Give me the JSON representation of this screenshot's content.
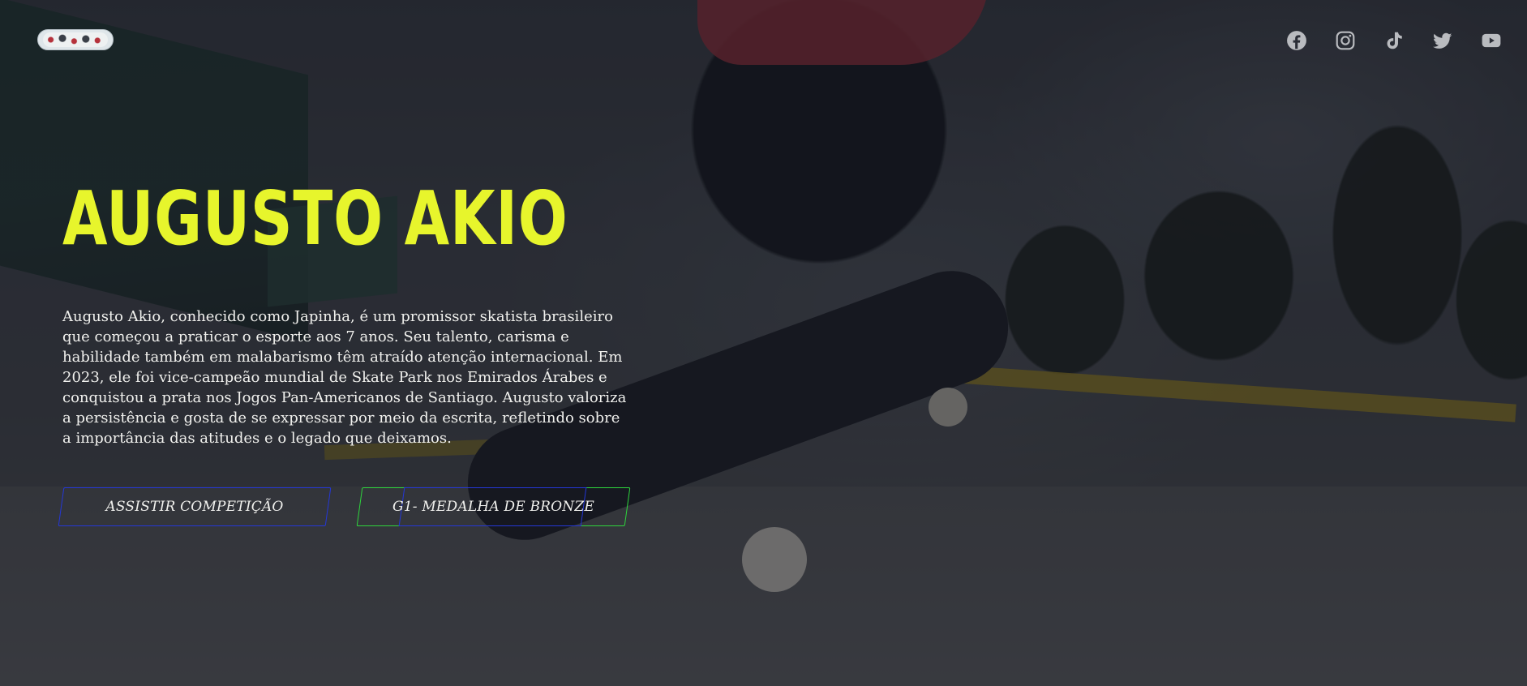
{
  "page": {
    "accent_color": "#e7f52c"
  },
  "header": {
    "logo_icon": "skateboard-logo-icon",
    "social": [
      {
        "name": "facebook",
        "icon": "facebook-icon"
      },
      {
        "name": "instagram",
        "icon": "instagram-icon"
      },
      {
        "name": "tiktok",
        "icon": "tiktok-icon"
      },
      {
        "name": "twitter",
        "icon": "twitter-icon"
      },
      {
        "name": "youtube",
        "icon": "youtube-icon"
      }
    ],
    "icon_color": "#b9bbbf"
  },
  "hero": {
    "title": "AUGUSTO AKIO",
    "description": "Augusto Akio, conhecido como Japinha, é um promissor skatista brasileiro que começou a praticar o esporte aos 7 anos. Seu talento, carisma e habilidade também em malabarismo têm atraído atenção internacional. Em 2023, ele foi vice-campeão mundial de Skate Park nos Emirados Árabes e conquistou a prata nos Jogos Pan-Americanos de Santiago. Augusto valoriza a persistência e gosta de se expressar por meio da escrita, refletindo sobre a importância das atitudes e o legado que deixamos.",
    "buttons": {
      "watch_label": "ASSISTIR COMPETIÇÃO",
      "watch_border_color": "#2437d8",
      "medal_label": "G1- MEDALHA DE BRONZE",
      "medal_border_color": "#2ed63d"
    }
  }
}
